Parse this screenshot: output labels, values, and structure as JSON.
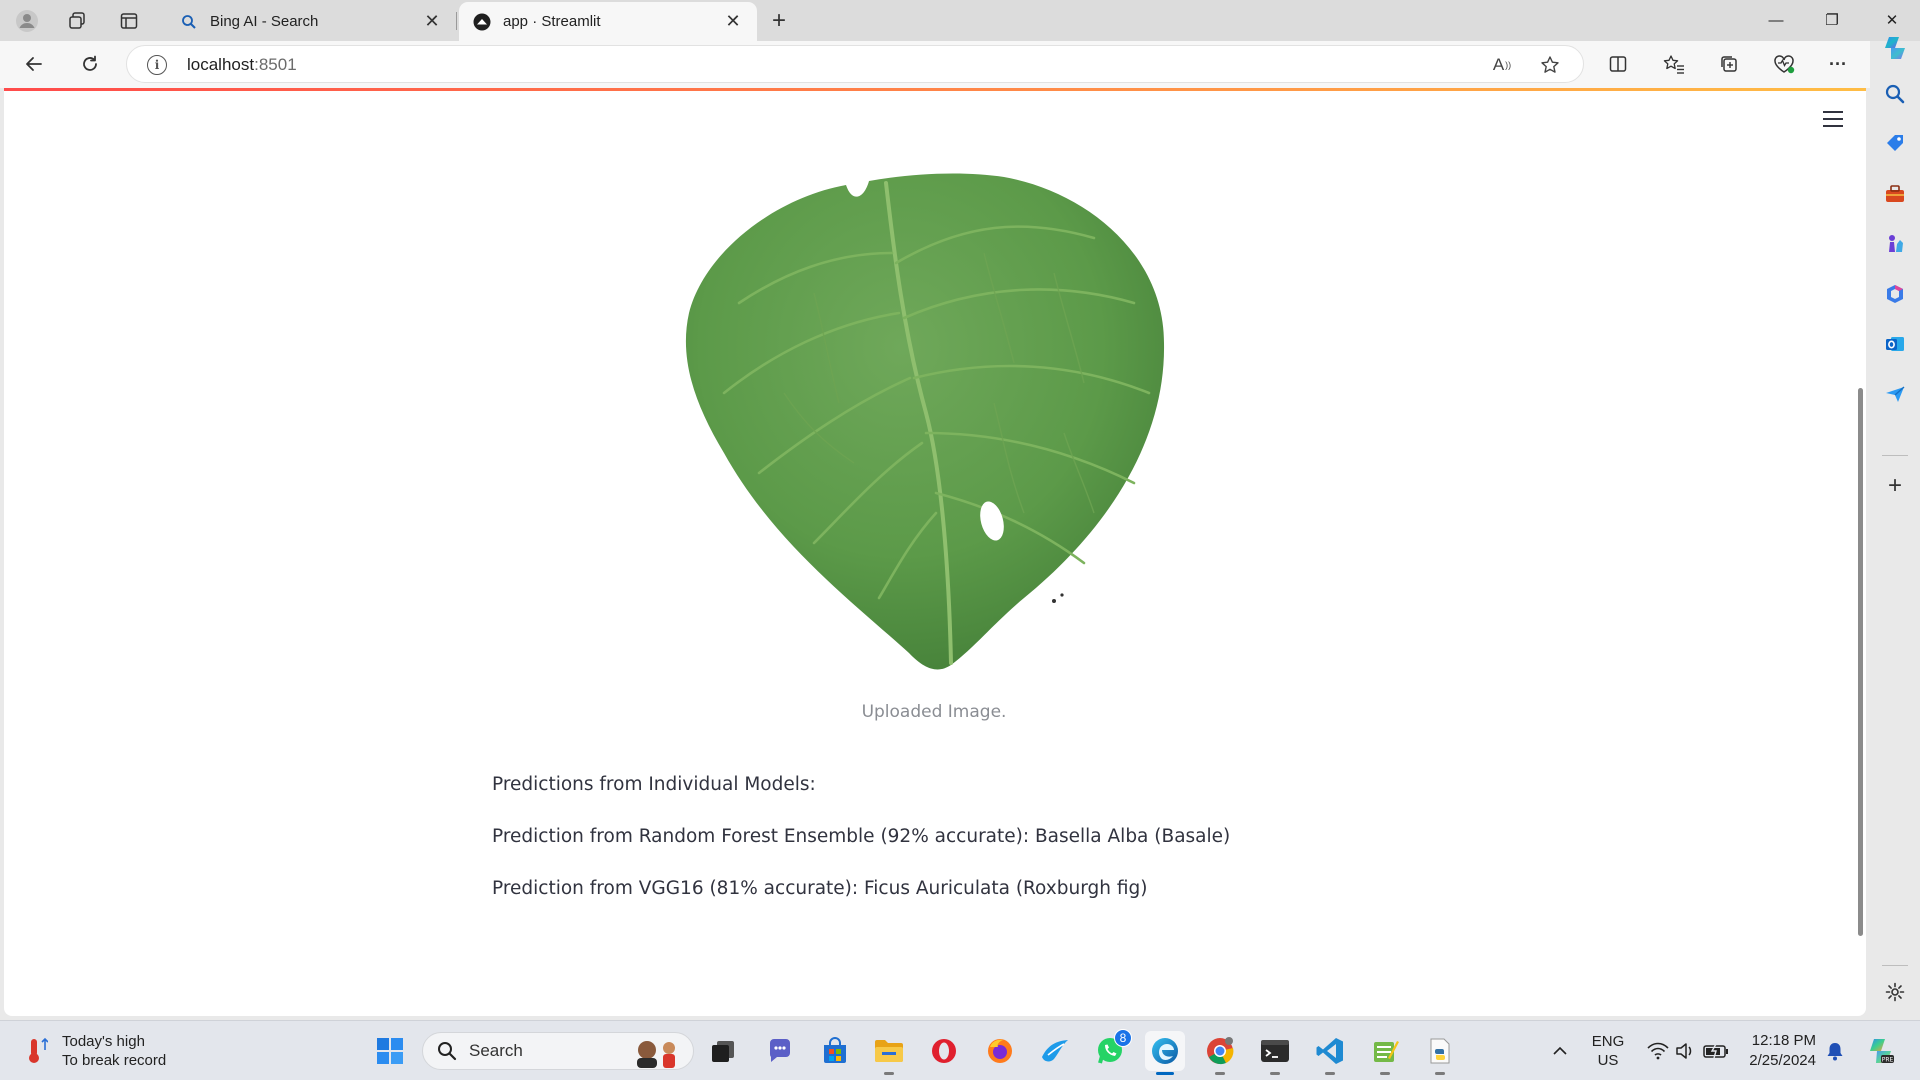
{
  "browser": {
    "tabs": [
      {
        "title": "Bing AI - Search",
        "icon": "search-icon"
      },
      {
        "title": "app · Streamlit",
        "icon": "streamlit-icon"
      }
    ],
    "new_tab_symbol": "+",
    "close_symbol": "✕",
    "window_controls": {
      "minimize": "—",
      "restore": "❐",
      "close": "✕"
    },
    "address": {
      "host": "localhost",
      "port": ":8501",
      "info_symbol": "i"
    },
    "read_aloud_label": "A",
    "more_symbol": "···"
  },
  "page": {
    "image_caption": "Uploaded Image.",
    "predictions_header": "Predictions from Individual Models:",
    "prediction_rf": "Prediction from Random Forest Ensemble (92% accurate): Basella Alba (Basale)",
    "prediction_vgg": "Prediction from VGG16 (81% accurate): Ficus Auriculata (Roxburgh fig)"
  },
  "sidebar": {
    "icons": [
      "search-icon",
      "tag-icon",
      "toolbox-icon",
      "chess-icon",
      "office-icon",
      "outlook-icon",
      "send-icon"
    ],
    "add_symbol": "+",
    "settings_icon": "gear-icon"
  },
  "taskbar": {
    "weather_line1": "Today's high",
    "weather_line2": "To break record",
    "search_label": "Search",
    "whatsapp_badge": "8",
    "language_line1": "ENG",
    "language_line2": "US",
    "time": "12:18 PM",
    "date": "2/25/2024"
  },
  "colors": {
    "streamlit_red": "#ff4b4b",
    "streamlit_orange": "#ffbd45",
    "text": "#31333f",
    "caption": "#8a8d93",
    "edge_blue": "#0067c0"
  }
}
